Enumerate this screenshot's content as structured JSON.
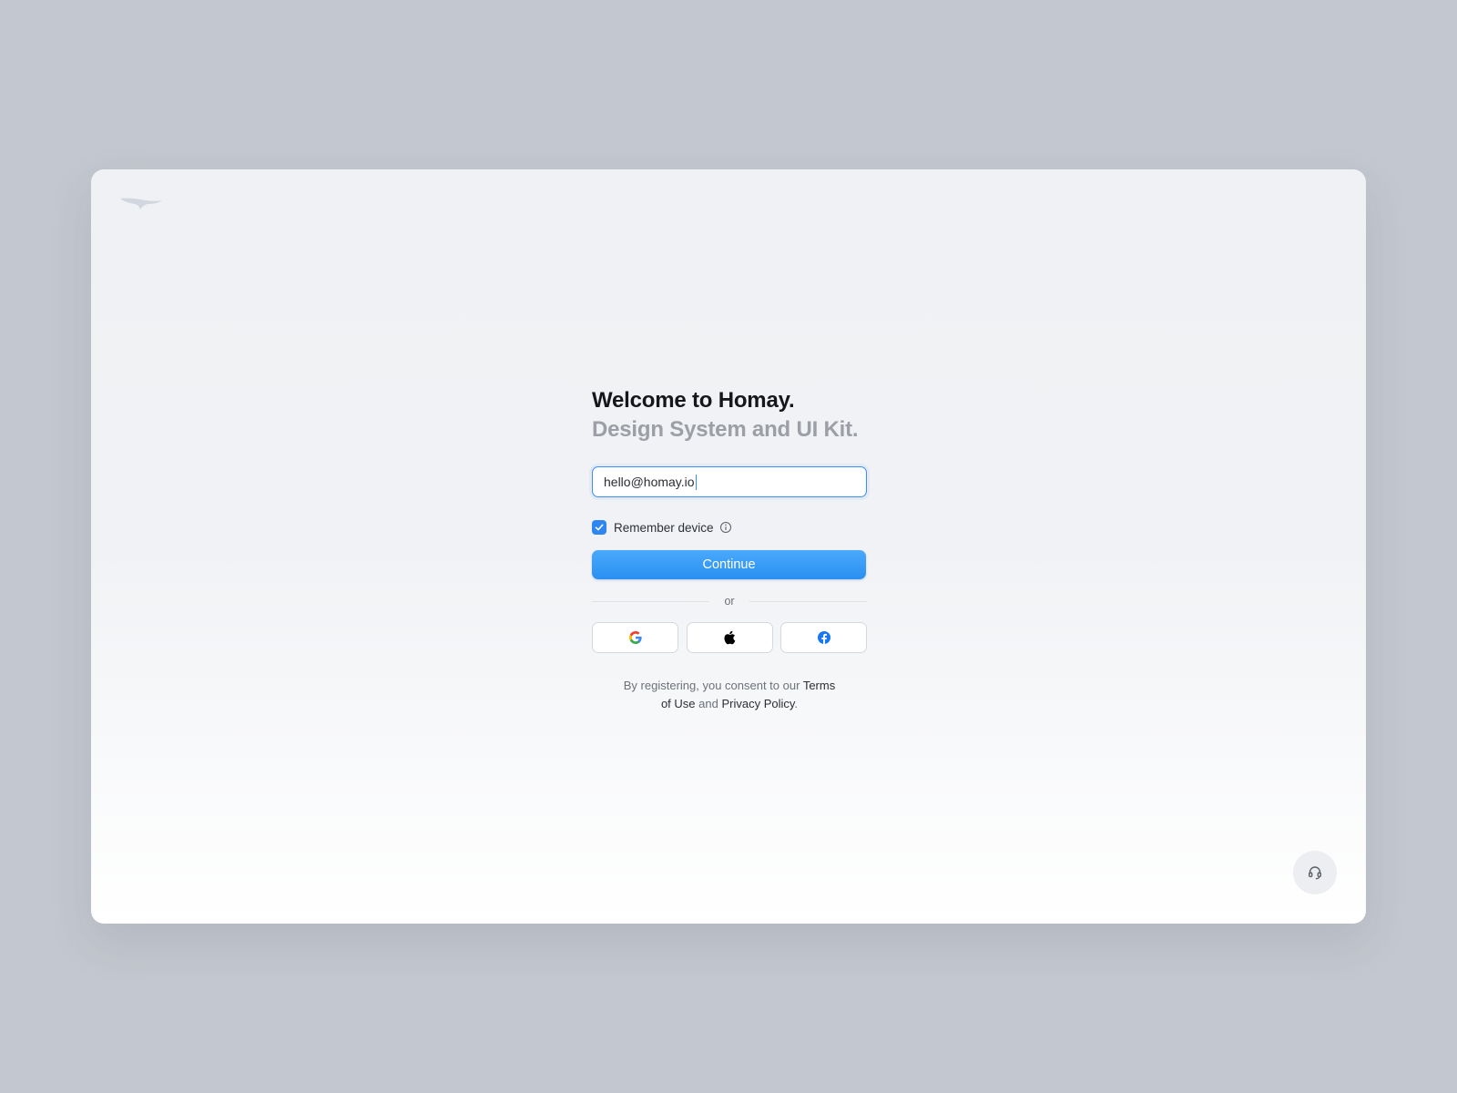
{
  "brand": {
    "logo_icon": "bird-logo-icon"
  },
  "header": {
    "title": "Welcome to Homay.",
    "subtitle": "Design System and UI Kit."
  },
  "email_field": {
    "value": "hello@homay.io",
    "focused": true
  },
  "remember_device": {
    "label": "Remember device",
    "checked": true,
    "info_icon": "info-icon"
  },
  "continue_button": {
    "label": "Continue"
  },
  "divider": {
    "label": "or"
  },
  "social_buttons": [
    {
      "name": "google",
      "icon": "google-icon"
    },
    {
      "name": "apple",
      "icon": "apple-icon"
    },
    {
      "name": "facebook",
      "icon": "facebook-icon"
    }
  ],
  "legal": {
    "prefix": "By registering, you consent to our",
    "terms_label": "Terms of Use",
    "conjunction": "and",
    "privacy_label": "Privacy Policy",
    "suffix": "."
  },
  "support": {
    "icon": "headset-icon"
  },
  "colors": {
    "accent": "#2f86ef",
    "page_background": "#c3c7cf",
    "title": "#15171c",
    "subtitle": "#9c9fa6"
  }
}
